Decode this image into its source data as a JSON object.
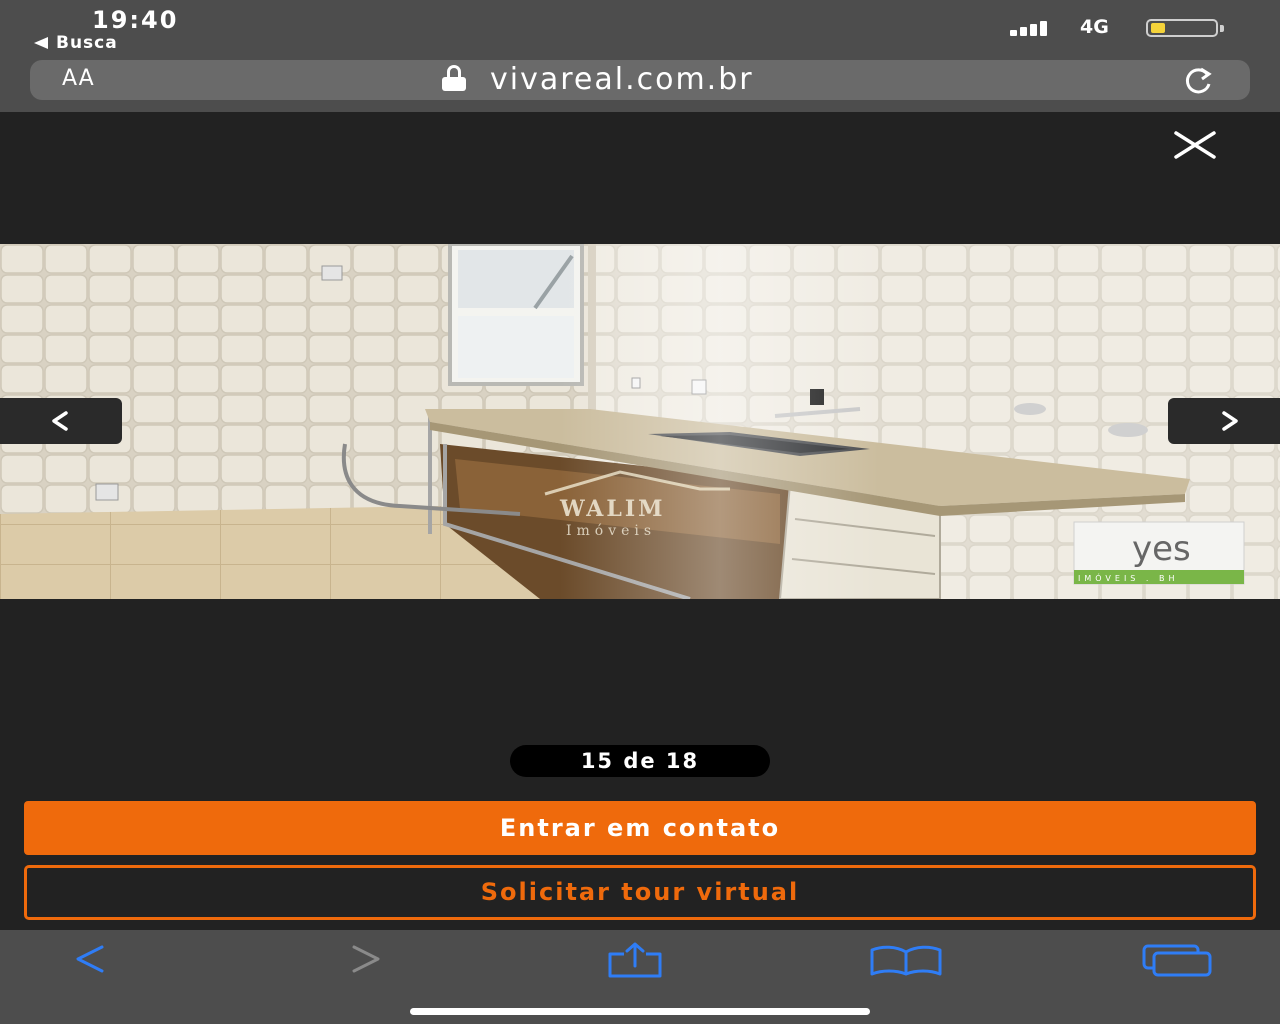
{
  "status_bar": {
    "time": "19:40",
    "back_app": "Busca",
    "network": "4G"
  },
  "url_bar": {
    "reader_label": "AA",
    "url": "vivareal.com.br"
  },
  "gallery": {
    "counter": "15 de 18",
    "watermark_brand": "WALIM",
    "watermark_sub": "Imóveis",
    "logo_text": "yes",
    "logo_sub": "IMÓVEIS . BH"
  },
  "actions": {
    "contact_label": "Entrar em contato",
    "tour_label": "Solicitar tour virtual"
  },
  "icons": {
    "close": "close-icon",
    "prev": "chevron-left-icon",
    "next": "chevron-right-icon",
    "share": "share-icon",
    "bookmarks": "book-icon",
    "tabs": "tabs-icon"
  },
  "colors": {
    "accent": "#ef6a0c",
    "ios_blue": "#2f7df6",
    "background": "#222222",
    "chrome": "#4d4d4d"
  }
}
